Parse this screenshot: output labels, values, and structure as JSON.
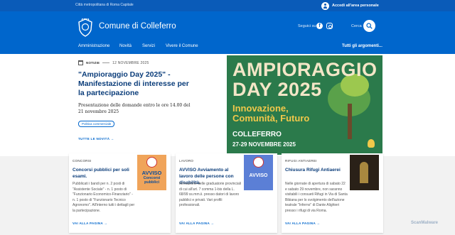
{
  "topbar": {
    "region": "Città metropolitana di Roma Capitale",
    "login_label": "Accedi all'area personale"
  },
  "header": {
    "site_name": "Comune di Colleferro",
    "social_label": "Seguici su",
    "search_label": "Cerca"
  },
  "nav": {
    "items": [
      "Amministrazione",
      "Novità",
      "Servizi",
      "Vivere il Comune"
    ],
    "all_topics": "Tutti gli argomenti..."
  },
  "hero": {
    "category": "NOTIZIE",
    "date": "12 NOVEMBRE 2025",
    "title": "\"Ampioraggio Day 2025\" - Manifestazione di interesse per la partecipazione",
    "description": "Presentazione delle domande entro le ore 14.00 del 21 novembre 2025",
    "chip": "Politica commerciale",
    "link": "TUTTE LE NOVITÀ",
    "poster": {
      "line1": "AMPIORAGGIO",
      "line2": "DAY 2025",
      "subtitle": "Innovazione, Comunità, Futuro",
      "city": "COLLEFERRO",
      "dates": "27-29 NOVEMBRE 2025"
    }
  },
  "cards": [
    {
      "category": "CONCORSI",
      "title": "Concorsi pubblici per soli esami.",
      "text": "Pubblicati i bandi per n. 2 posti di \"Assistente Sociale\" - n. 1 posto di \"Funzionario Economico-Finanziario\" - n. 1 posto di \"Funzionario Tecnico Agronomo\". All'interno tutti i dettagli per la partecipazione.",
      "link": "VAI ALLA PAGINA",
      "thumb_title": "AVVISO",
      "thumb_sub": "Concorsi pubblici"
    },
    {
      "category": "LAVORO",
      "title": "AVVISO Avviamento al lavoro delle persone con disabilità.",
      "text": "formazione delle graduatorie provinciali di cui all'art. 7 comma 1-bis della L. 68/99 ss.mm.ii. presso datori di lavoro pubblici e privati. Vari profili professionali.",
      "link": "VAI ALLA PAGINA",
      "thumb_title": "AVVISO"
    },
    {
      "category": "RIFUGI ANTIAEREI",
      "title": "Chiusura Rifugi Antiaerei",
      "text": "Nelle giornate di apertura di sabato 22 e sabato 29 novembre, non saranno visitabili i consueti Rifugi in Via di Santa Bibiana per lo svolgimento dell'azione teatrale \"Inferno\" di Dante Alighieri presso i rifugi di via Roma.",
      "link": "VAI ALLA PAGINA"
    }
  ],
  "watermark": "ScanMalware",
  "colors": {
    "primary": "#0066cc",
    "topbar": "#0a5bb8",
    "title": "#0b3d7a",
    "poster_bg": "#2b7a4b"
  }
}
